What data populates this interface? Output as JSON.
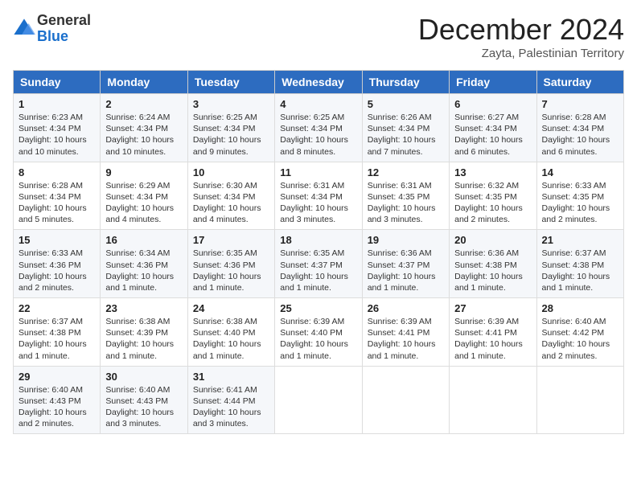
{
  "logo": {
    "general": "General",
    "blue": "Blue"
  },
  "title": "December 2024",
  "location": "Zayta, Palestinian Territory",
  "headers": [
    "Sunday",
    "Monday",
    "Tuesday",
    "Wednesday",
    "Thursday",
    "Friday",
    "Saturday"
  ],
  "weeks": [
    [
      {
        "day": "1",
        "lines": [
          "Sunrise: 6:23 AM",
          "Sunset: 4:34 PM",
          "Daylight: 10 hours",
          "and 10 minutes."
        ]
      },
      {
        "day": "2",
        "lines": [
          "Sunrise: 6:24 AM",
          "Sunset: 4:34 PM",
          "Daylight: 10 hours",
          "and 10 minutes."
        ]
      },
      {
        "day": "3",
        "lines": [
          "Sunrise: 6:25 AM",
          "Sunset: 4:34 PM",
          "Daylight: 10 hours",
          "and 9 minutes."
        ]
      },
      {
        "day": "4",
        "lines": [
          "Sunrise: 6:25 AM",
          "Sunset: 4:34 PM",
          "Daylight: 10 hours",
          "and 8 minutes."
        ]
      },
      {
        "day": "5",
        "lines": [
          "Sunrise: 6:26 AM",
          "Sunset: 4:34 PM",
          "Daylight: 10 hours",
          "and 7 minutes."
        ]
      },
      {
        "day": "6",
        "lines": [
          "Sunrise: 6:27 AM",
          "Sunset: 4:34 PM",
          "Daylight: 10 hours",
          "and 6 minutes."
        ]
      },
      {
        "day": "7",
        "lines": [
          "Sunrise: 6:28 AM",
          "Sunset: 4:34 PM",
          "Daylight: 10 hours",
          "and 6 minutes."
        ]
      }
    ],
    [
      {
        "day": "8",
        "lines": [
          "Sunrise: 6:28 AM",
          "Sunset: 4:34 PM",
          "Daylight: 10 hours",
          "and 5 minutes."
        ]
      },
      {
        "day": "9",
        "lines": [
          "Sunrise: 6:29 AM",
          "Sunset: 4:34 PM",
          "Daylight: 10 hours",
          "and 4 minutes."
        ]
      },
      {
        "day": "10",
        "lines": [
          "Sunrise: 6:30 AM",
          "Sunset: 4:34 PM",
          "Daylight: 10 hours",
          "and 4 minutes."
        ]
      },
      {
        "day": "11",
        "lines": [
          "Sunrise: 6:31 AM",
          "Sunset: 4:34 PM",
          "Daylight: 10 hours",
          "and 3 minutes."
        ]
      },
      {
        "day": "12",
        "lines": [
          "Sunrise: 6:31 AM",
          "Sunset: 4:35 PM",
          "Daylight: 10 hours",
          "and 3 minutes."
        ]
      },
      {
        "day": "13",
        "lines": [
          "Sunrise: 6:32 AM",
          "Sunset: 4:35 PM",
          "Daylight: 10 hours",
          "and 2 minutes."
        ]
      },
      {
        "day": "14",
        "lines": [
          "Sunrise: 6:33 AM",
          "Sunset: 4:35 PM",
          "Daylight: 10 hours",
          "and 2 minutes."
        ]
      }
    ],
    [
      {
        "day": "15",
        "lines": [
          "Sunrise: 6:33 AM",
          "Sunset: 4:36 PM",
          "Daylight: 10 hours",
          "and 2 minutes."
        ]
      },
      {
        "day": "16",
        "lines": [
          "Sunrise: 6:34 AM",
          "Sunset: 4:36 PM",
          "Daylight: 10 hours",
          "and 1 minute."
        ]
      },
      {
        "day": "17",
        "lines": [
          "Sunrise: 6:35 AM",
          "Sunset: 4:36 PM",
          "Daylight: 10 hours",
          "and 1 minute."
        ]
      },
      {
        "day": "18",
        "lines": [
          "Sunrise: 6:35 AM",
          "Sunset: 4:37 PM",
          "Daylight: 10 hours",
          "and 1 minute."
        ]
      },
      {
        "day": "19",
        "lines": [
          "Sunrise: 6:36 AM",
          "Sunset: 4:37 PM",
          "Daylight: 10 hours",
          "and 1 minute."
        ]
      },
      {
        "day": "20",
        "lines": [
          "Sunrise: 6:36 AM",
          "Sunset: 4:38 PM",
          "Daylight: 10 hours",
          "and 1 minute."
        ]
      },
      {
        "day": "21",
        "lines": [
          "Sunrise: 6:37 AM",
          "Sunset: 4:38 PM",
          "Daylight: 10 hours",
          "and 1 minute."
        ]
      }
    ],
    [
      {
        "day": "22",
        "lines": [
          "Sunrise: 6:37 AM",
          "Sunset: 4:38 PM",
          "Daylight: 10 hours",
          "and 1 minute."
        ]
      },
      {
        "day": "23",
        "lines": [
          "Sunrise: 6:38 AM",
          "Sunset: 4:39 PM",
          "Daylight: 10 hours",
          "and 1 minute."
        ]
      },
      {
        "day": "24",
        "lines": [
          "Sunrise: 6:38 AM",
          "Sunset: 4:40 PM",
          "Daylight: 10 hours",
          "and 1 minute."
        ]
      },
      {
        "day": "25",
        "lines": [
          "Sunrise: 6:39 AM",
          "Sunset: 4:40 PM",
          "Daylight: 10 hours",
          "and 1 minute."
        ]
      },
      {
        "day": "26",
        "lines": [
          "Sunrise: 6:39 AM",
          "Sunset: 4:41 PM",
          "Daylight: 10 hours",
          "and 1 minute."
        ]
      },
      {
        "day": "27",
        "lines": [
          "Sunrise: 6:39 AM",
          "Sunset: 4:41 PM",
          "Daylight: 10 hours",
          "and 1 minute."
        ]
      },
      {
        "day": "28",
        "lines": [
          "Sunrise: 6:40 AM",
          "Sunset: 4:42 PM",
          "Daylight: 10 hours",
          "and 2 minutes."
        ]
      }
    ],
    [
      {
        "day": "29",
        "lines": [
          "Sunrise: 6:40 AM",
          "Sunset: 4:43 PM",
          "Daylight: 10 hours",
          "and 2 minutes."
        ]
      },
      {
        "day": "30",
        "lines": [
          "Sunrise: 6:40 AM",
          "Sunset: 4:43 PM",
          "Daylight: 10 hours",
          "and 3 minutes."
        ]
      },
      {
        "day": "31",
        "lines": [
          "Sunrise: 6:41 AM",
          "Sunset: 4:44 PM",
          "Daylight: 10 hours",
          "and 3 minutes."
        ]
      },
      null,
      null,
      null,
      null
    ]
  ]
}
